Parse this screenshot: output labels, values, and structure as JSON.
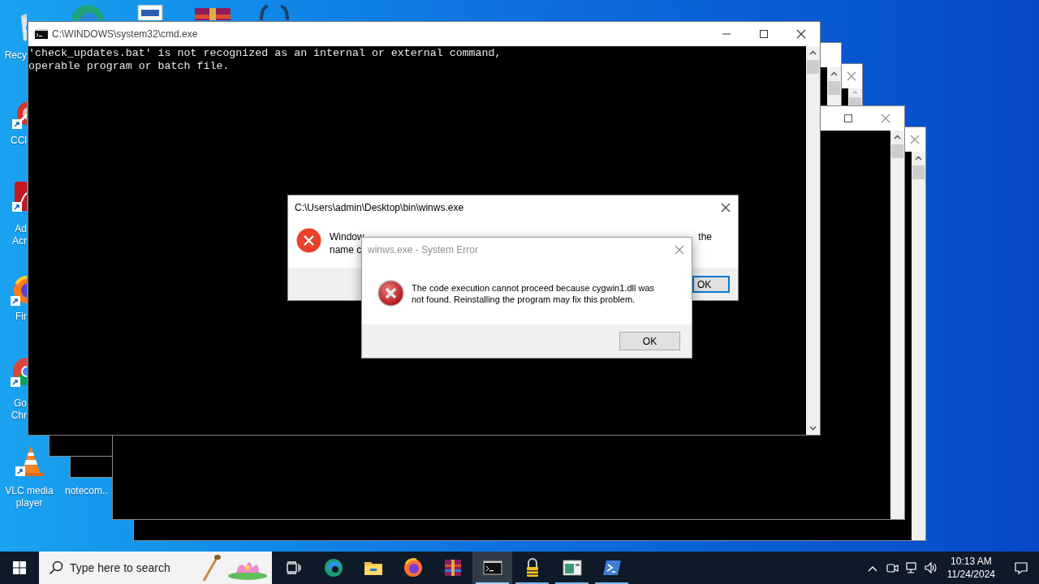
{
  "desktop": {
    "icons": [
      {
        "kind": "bin",
        "label": "Recy"
      },
      {
        "kind": "ccleaner",
        "label": "CCl"
      },
      {
        "kind": "acrobat",
        "label": "Ad\nAcr"
      },
      {
        "kind": "firefox",
        "label": "Fir"
      },
      {
        "kind": "chrome",
        "label": "Go\nChr"
      },
      {
        "kind": "vlc",
        "label": "VLC media\nplayer"
      },
      {
        "kind": "covered",
        "label": "notecom.."
      }
    ]
  },
  "console": {
    "title": "C:\\WINDOWS\\system32\\cmd.exe",
    "lines": [
      "'check_updates.bat' is not recognized as an internal or external command,",
      "operable program or batch file."
    ]
  },
  "dialogs": [
    {
      "kind": "shell",
      "title": "C:\\Users\\admin\\Desktop\\bin\\winws.exe",
      "message_fragments": [
        "Window",
        "the",
        "name c"
      ],
      "button": "OK"
    },
    {
      "kind": "system",
      "title": "winws.exe - System Error",
      "message": "The code execution cannot proceed because cygwin1.dll was not found. Reinstalling the program may fix this problem.",
      "button": "OK"
    }
  ],
  "taskbar": {
    "search_placeholder": "Type here to search",
    "apps": [
      {
        "kind": "edge",
        "running": false,
        "active": false
      },
      {
        "kind": "explorer",
        "running": false,
        "active": false
      },
      {
        "kind": "firefox",
        "running": false,
        "active": false
      },
      {
        "kind": "winrar",
        "running": false,
        "active": false
      },
      {
        "kind": "cmd",
        "running": true,
        "active": true
      },
      {
        "kind": "lock",
        "running": true,
        "active": false
      },
      {
        "kind": "app",
        "running": true,
        "active": false
      },
      {
        "kind": "powershell",
        "running": true,
        "active": false
      }
    ],
    "clock": {
      "time": "10:13 AM",
      "date": "11/24/2024"
    }
  }
}
